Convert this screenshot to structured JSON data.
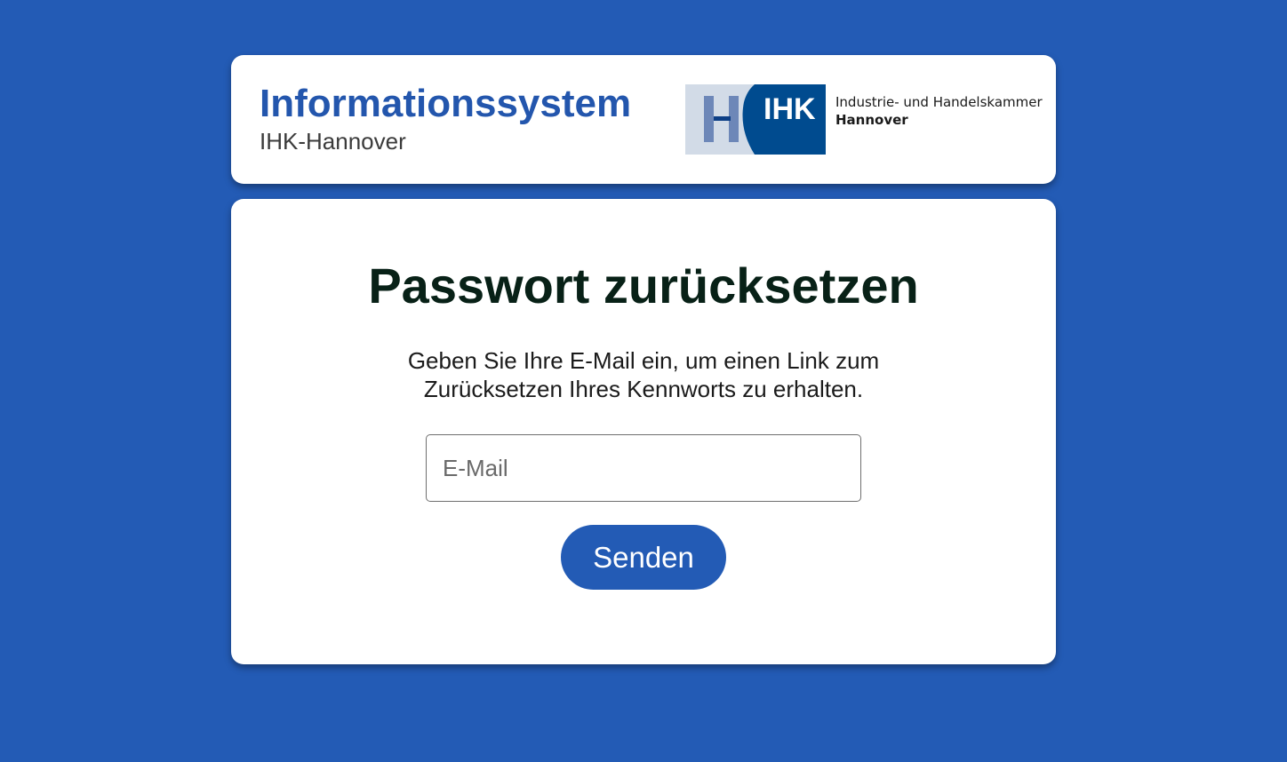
{
  "header": {
    "title": "Informationssystem",
    "subtitle": "IHK-Hannover",
    "logo": {
      "short_name": "IHK",
      "line1": "Industrie- und Handelskammer",
      "line2": "Hannover"
    }
  },
  "form": {
    "title": "Passwort zurücksetzen",
    "instructions": "Geben Sie Ihre E-Mail ein, um einen Link zum Zurücksetzen Ihres Kennworts zu erhalten.",
    "email_placeholder": "E-Mail",
    "email_value": "",
    "submit_label": "Senden"
  },
  "colors": {
    "background": "#235bb5",
    "brand_blue": "#2356ad",
    "logo_dark_blue": "#004b8f",
    "logo_light_blue": "#d2dbe7",
    "button": "#235bb5",
    "title_text": "#082117"
  }
}
